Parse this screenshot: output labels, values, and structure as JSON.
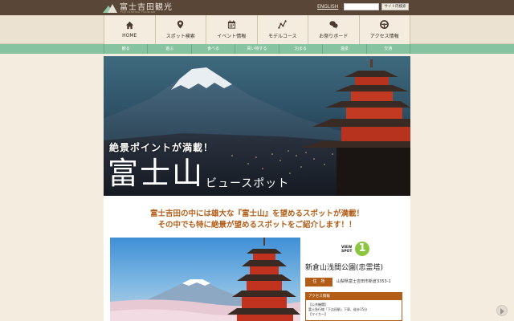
{
  "header": {
    "logo_text": "富士吉田観光",
    "logo_sub": "FUJIYOSHIDA TOURISM",
    "english_link": "ENGLISH",
    "search_placeholder": "",
    "search_button": "サイト内検索"
  },
  "main_nav": [
    {
      "label": "HOME",
      "icon": "home-icon"
    },
    {
      "label": "スポット検索",
      "icon": "map-pin-icon"
    },
    {
      "label": "イベント情報",
      "icon": "calendar-icon"
    },
    {
      "label": "モデルコース",
      "icon": "route-icon"
    },
    {
      "label": "お祭りボード",
      "icon": "speech-bubble-icon"
    },
    {
      "label": "アクセス情報",
      "icon": "steering-wheel-icon"
    }
  ],
  "sub_nav": [
    "観る",
    "遊ぶ",
    "食べる",
    "買い物する",
    "泊まる",
    "温泉",
    "交通"
  ],
  "hero": {
    "caption": "絶景ポイントが満載！",
    "title": "富士山",
    "title_sub": "ビュースポット"
  },
  "lead": [
    "富士吉田の中には雄大な『富士山』を望めるスポットが満載！",
    "その中でも特に絶景が望めるスポットをご紹介します！！"
  ],
  "spot": {
    "view_label_1": "VIEW",
    "view_label_2": "SPOT",
    "number": "1",
    "name": "新倉山浅間公園(忠霊塔)",
    "address_label": "住　所",
    "address": "山梨県富士吉田市新倉3353-1",
    "access_title": "アクセス情報",
    "access_lines": [
      "【公共機関】",
      "富士急行線「下吉田駅」下車、徒歩15分",
      "【マイカー】"
    ]
  },
  "colors": {
    "header_bg": "#5a4636",
    "accent_orange": "#b25e19",
    "subnav_green": "#86c3a0",
    "spot_badge_green": "#8cc63f"
  }
}
